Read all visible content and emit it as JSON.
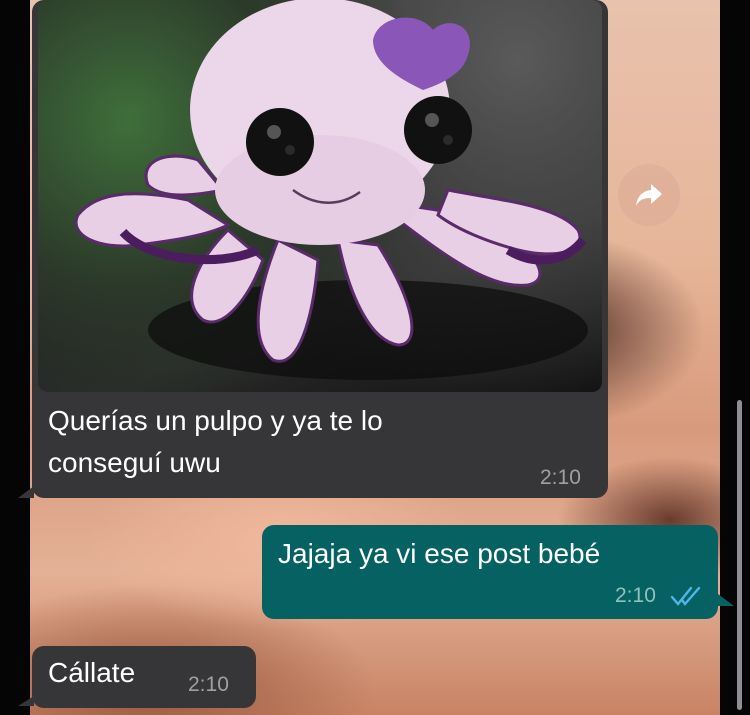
{
  "chat": {
    "messages": [
      {
        "direction": "incoming",
        "type": "image",
        "image_subject": "pink felt octopus plush with button eyes and purple bow",
        "caption": "Querías un pulpo y ya te lo\nconseguí uwu",
        "time": "2:10"
      },
      {
        "direction": "outgoing",
        "type": "text",
        "text": "Jajaja ya vi ese post bebé",
        "time": "2:10",
        "status": "read"
      },
      {
        "direction": "incoming",
        "type": "text",
        "text": "Cállate",
        "time": "2:10"
      }
    ],
    "forward_button": {
      "icon": "forward-arrow-icon"
    },
    "colors": {
      "incoming_bubble": "#363638",
      "outgoing_bubble": "#056162",
      "read_ticks": "#4fb6ec"
    }
  }
}
